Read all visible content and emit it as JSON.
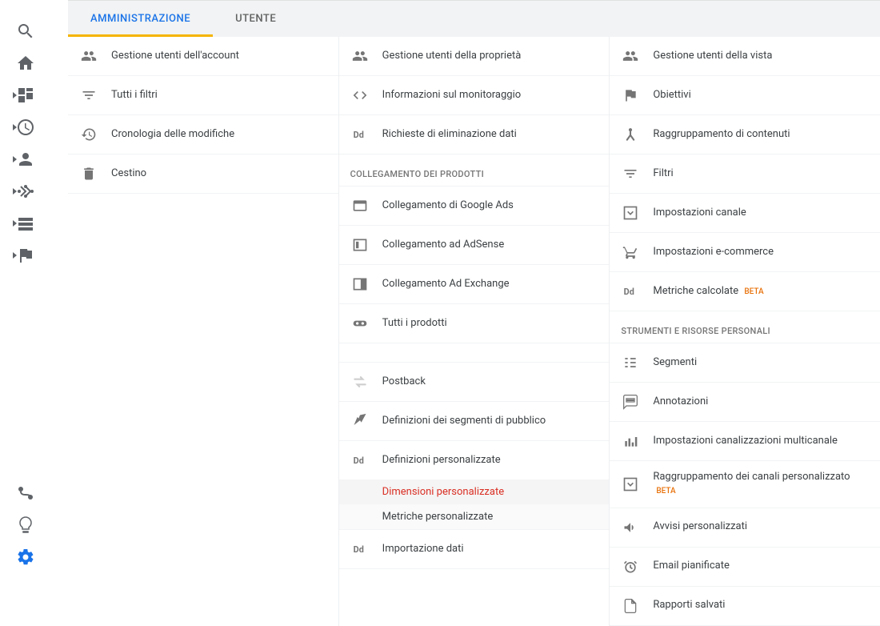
{
  "tabs": {
    "admin": "AMMINISTRAZIONE",
    "user": "UTENTE"
  },
  "col1": {
    "items": [
      {
        "label": "Gestione utenti dell'account"
      },
      {
        "label": "Tutti i filtri"
      },
      {
        "label": "Cronologia delle modifiche"
      },
      {
        "label": "Cestino"
      }
    ]
  },
  "col2": {
    "items": [
      {
        "label": "Gestione utenti della proprietà"
      },
      {
        "label": "Informazioni sul monitoraggio"
      },
      {
        "label": "Richieste di eliminazione dati"
      }
    ],
    "section1": "COLLEGAMENTO DEI PRODOTTI",
    "products": [
      {
        "label": "Collegamento di Google Ads"
      },
      {
        "label": "Collegamento ad AdSense"
      },
      {
        "label": "Collegamento Ad Exchange"
      },
      {
        "label": "Tutti i prodotti"
      }
    ],
    "postback": "Postback",
    "audience": "Definizioni dei segmenti di pubblico",
    "custom_def": "Definizioni personalizzate",
    "custom_sub1": "Dimensioni personalizzate",
    "custom_sub2": "Metriche personalizzate",
    "import": "Importazione dati"
  },
  "col3": {
    "items1": [
      {
        "label": "Gestione utenti della vista"
      },
      {
        "label": "Obiettivi"
      },
      {
        "label": "Raggruppamento di contenuti"
      },
      {
        "label": "Filtri"
      },
      {
        "label": "Impostazioni canale"
      },
      {
        "label": "Impostazioni e-commerce"
      }
    ],
    "calc_metrics": "Metriche calcolate",
    "beta": "BETA",
    "section": "STRUMENTI E RISORSE PERSONALI",
    "items2": [
      {
        "label": "Segmenti"
      },
      {
        "label": "Annotazioni"
      },
      {
        "label": "Impostazioni canalizzazioni multicanale"
      }
    ],
    "custom_channel": "Raggruppamento dei canali personalizzato",
    "items3": [
      {
        "label": "Avvisi personalizzati"
      },
      {
        "label": "Email pianificate"
      },
      {
        "label": "Rapporti salvati"
      }
    ]
  }
}
